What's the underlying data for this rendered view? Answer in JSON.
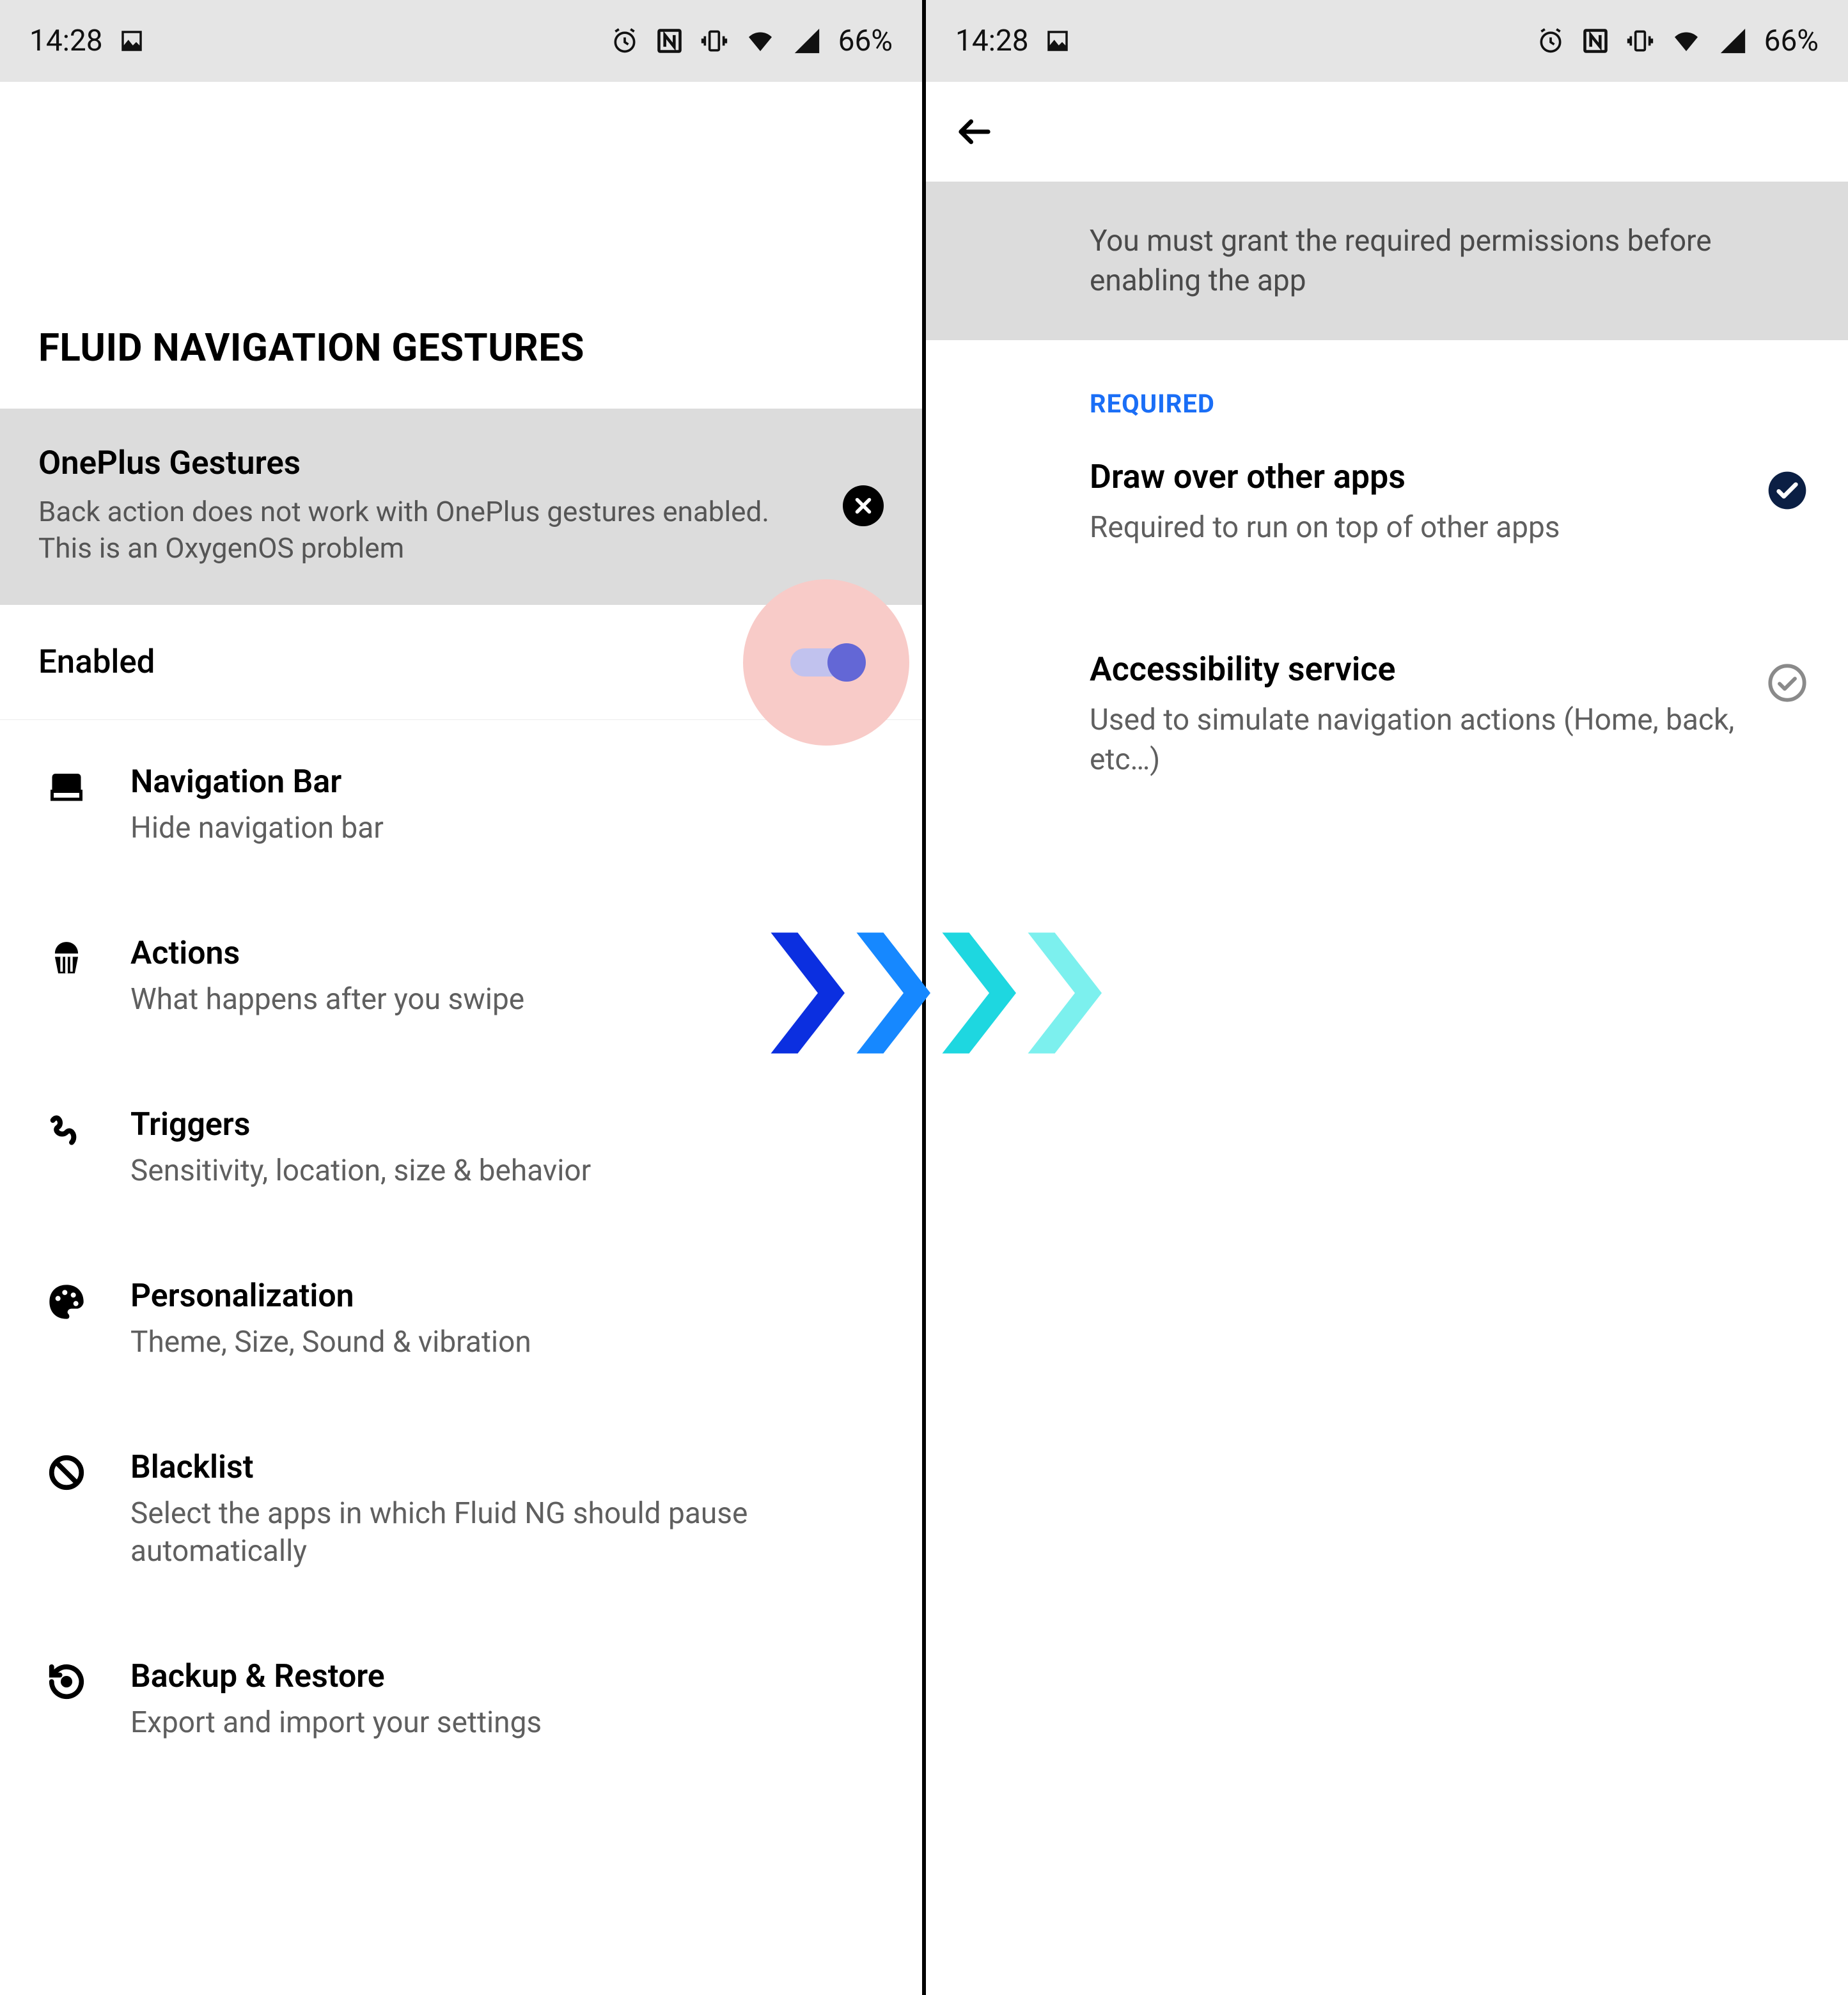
{
  "status_bar": {
    "time": "14:28",
    "battery": "66%"
  },
  "left": {
    "hero_title": "FLUID NAVIGATION GESTURES",
    "banner": {
      "title": "OnePlus Gestures",
      "desc": "Back action does not work with OnePlus gestures enabled. This is an OxygenOS problem"
    },
    "enabled_label": "Enabled",
    "settings": [
      {
        "title": "Navigation Bar",
        "desc": "Hide navigation bar"
      },
      {
        "title": "Actions",
        "desc": "What happens after you swipe"
      },
      {
        "title": "Triggers",
        "desc": "Sensitivity, location, size & behavior"
      },
      {
        "title": "Personalization",
        "desc": "Theme, Size, Sound & vibration"
      },
      {
        "title": "Blacklist",
        "desc": "Select the apps in which Fluid NG should pause automatically"
      },
      {
        "title": "Backup & Restore",
        "desc": "Export and import your settings"
      }
    ]
  },
  "right": {
    "banner": "You must grant the required permissions before enabling the app",
    "header": "REQUIRED",
    "perms": [
      {
        "title": "Draw over other apps",
        "desc": "Required to run on top of other apps",
        "granted": true
      },
      {
        "title": "Accessibility service",
        "desc": "Used to simulate navigation actions (Home, back, etc…)",
        "granted": false
      }
    ]
  }
}
